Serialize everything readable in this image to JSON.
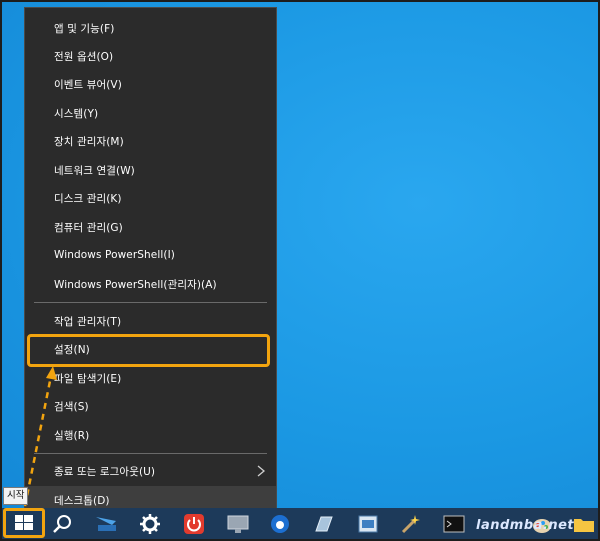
{
  "menu": {
    "items": [
      {
        "label": "앱 및 기능(F)"
      },
      {
        "label": "전원 옵션(O)"
      },
      {
        "label": "이벤트 뷰어(V)"
      },
      {
        "label": "시스템(Y)"
      },
      {
        "label": "장치 관리자(M)"
      },
      {
        "label": "네트워크 연결(W)"
      },
      {
        "label": "디스크 관리(K)"
      },
      {
        "label": "컴퓨터 관리(G)"
      },
      {
        "label": "Windows PowerShell(I)"
      },
      {
        "label": "Windows PowerShell(관리자)(A)"
      },
      {
        "label": "작업 관리자(T)"
      },
      {
        "label": "설정(N)"
      },
      {
        "label": "파일 탐색기(E)"
      },
      {
        "label": "검색(S)"
      },
      {
        "label": "실행(R)"
      },
      {
        "label": "종료 또는 로그아웃(U)",
        "submenu": true
      },
      {
        "label": "데스크톱(D)"
      }
    ],
    "highlighted_item": "설정(N)"
  },
  "tooltip": {
    "text": "시작"
  },
  "watermark": {
    "text": "landmba.net"
  },
  "colors": {
    "accent": "#f2a40f",
    "menu_bg": "#2b2b2b",
    "desktop": "#1a9ae6",
    "taskbar": "#1d3a5a"
  },
  "taskbar": {
    "icons": [
      "windows-start-icon",
      "search-icon",
      "cortana-icon",
      "settings-gear-icon",
      "power-icon",
      "monitor-icon",
      "edge-icon",
      "pen-tablet-icon",
      "photo-viewer-icon",
      "magic-wand-icon",
      "terminal-icon",
      "paint-icon",
      "folder-icon"
    ]
  }
}
